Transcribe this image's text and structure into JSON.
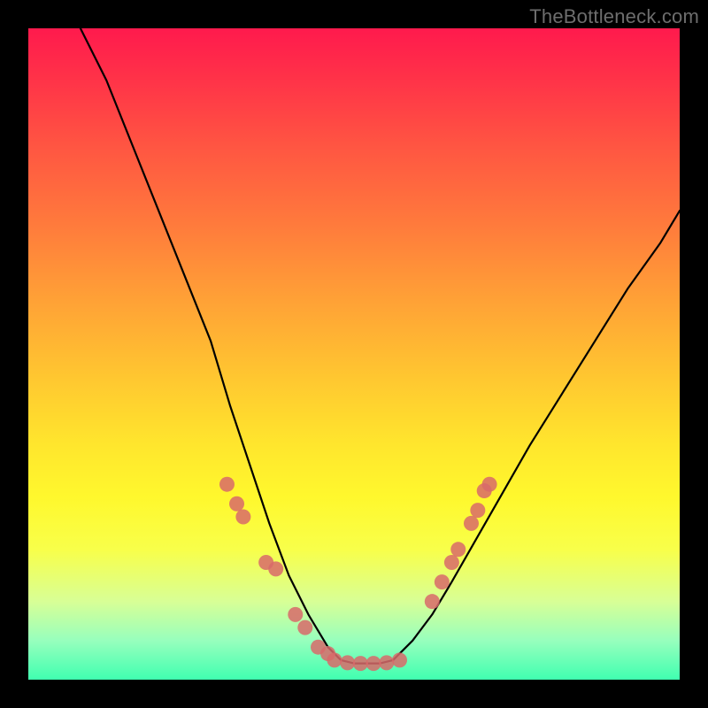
{
  "watermark": "TheBottleneck.com",
  "chart_data": {
    "type": "line",
    "title": "",
    "xlabel": "",
    "ylabel": "",
    "xlim": [
      0,
      100
    ],
    "ylim": [
      0,
      100
    ],
    "series": [
      {
        "name": "curve-left",
        "style": "line-black",
        "x": [
          8,
          12,
          16,
          20,
          24,
          28,
          31,
          34,
          37,
          40,
          43,
          46,
          48
        ],
        "y": [
          100,
          92,
          82,
          72,
          62,
          52,
          42,
          33,
          24,
          16,
          10,
          5,
          3
        ]
      },
      {
        "name": "curve-bottom",
        "style": "line-black",
        "x": [
          48,
          50,
          52,
          54,
          56
        ],
        "y": [
          3,
          2.5,
          2.5,
          2.5,
          3
        ]
      },
      {
        "name": "curve-right",
        "style": "line-black",
        "x": [
          56,
          59,
          62,
          65,
          69,
          73,
          77,
          82,
          87,
          92,
          97,
          100
        ],
        "y": [
          3,
          6,
          10,
          15,
          22,
          29,
          36,
          44,
          52,
          60,
          67,
          72
        ]
      },
      {
        "name": "dots-left",
        "style": "dot-pink",
        "x": [
          30.5,
          32,
          33,
          36.5,
          38,
          41,
          42.5,
          44.5,
          46
        ],
        "y": [
          30,
          27,
          25,
          18,
          17,
          10,
          8,
          5,
          4
        ]
      },
      {
        "name": "dots-bottom",
        "style": "dot-pink",
        "x": [
          47,
          49,
          51,
          53,
          55,
          57
        ],
        "y": [
          3,
          2.6,
          2.5,
          2.5,
          2.6,
          3
        ]
      },
      {
        "name": "dots-right",
        "style": "dot-pink",
        "x": [
          62,
          63.5,
          65,
          66,
          68,
          69,
          70,
          70.8
        ],
        "y": [
          12,
          15,
          18,
          20,
          24,
          26,
          29,
          30
        ]
      }
    ],
    "colors": {
      "line-black": "#000000",
      "dot-pink": "#d86a6a"
    }
  }
}
